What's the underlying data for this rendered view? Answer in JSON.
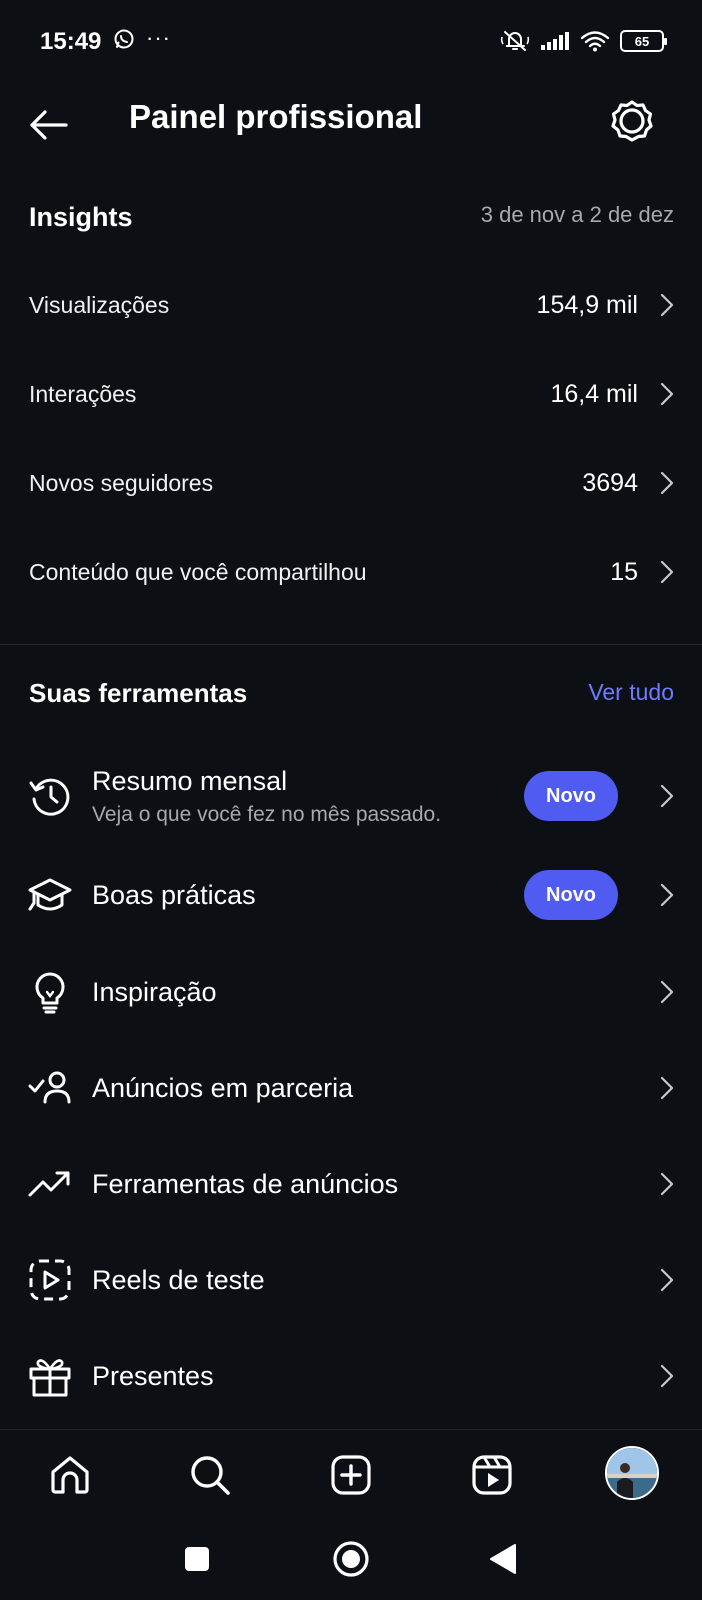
{
  "status_bar": {
    "time": "15:49",
    "battery": "65",
    "dots": "···"
  },
  "header": {
    "title": "Painel profissional"
  },
  "insights": {
    "title": "Insights",
    "date_range": "3 de nov a 2 de dez",
    "rows": [
      {
        "label": "Visualizações",
        "value": "154,9 mil"
      },
      {
        "label": "Interações",
        "value": "16,4 mil"
      },
      {
        "label": "Novos seguidores",
        "value": "3694"
      },
      {
        "label": "Conteúdo que você compartilhou",
        "value": "15"
      }
    ]
  },
  "tools": {
    "title": "Suas ferramentas",
    "see_all": "Ver tudo",
    "items": [
      {
        "label": "Resumo mensal",
        "subtitle": "Veja o que você fez no mês passado.",
        "badge": "Novo",
        "icon": "history-icon"
      },
      {
        "label": "Boas práticas",
        "badge": "Novo",
        "icon": "graduation-cap-icon"
      },
      {
        "label": "Inspiração",
        "icon": "lightbulb-icon"
      },
      {
        "label": "Anúncios em parceria",
        "icon": "partner-check-icon"
      },
      {
        "label": "Ferramentas de anúncios",
        "icon": "trending-up-icon"
      },
      {
        "label": "Reels de teste",
        "icon": "reel-test-icon"
      },
      {
        "label": "Presentes",
        "icon": "gift-icon"
      }
    ]
  },
  "bottom_nav": [
    "home-icon",
    "search-icon",
    "create-icon",
    "reels-icon",
    "profile-avatar"
  ],
  "colors": {
    "background": "#0c0f14",
    "accent": "#4f5bf1",
    "link": "#6f7bff",
    "muted_text": "#a6a9af"
  }
}
